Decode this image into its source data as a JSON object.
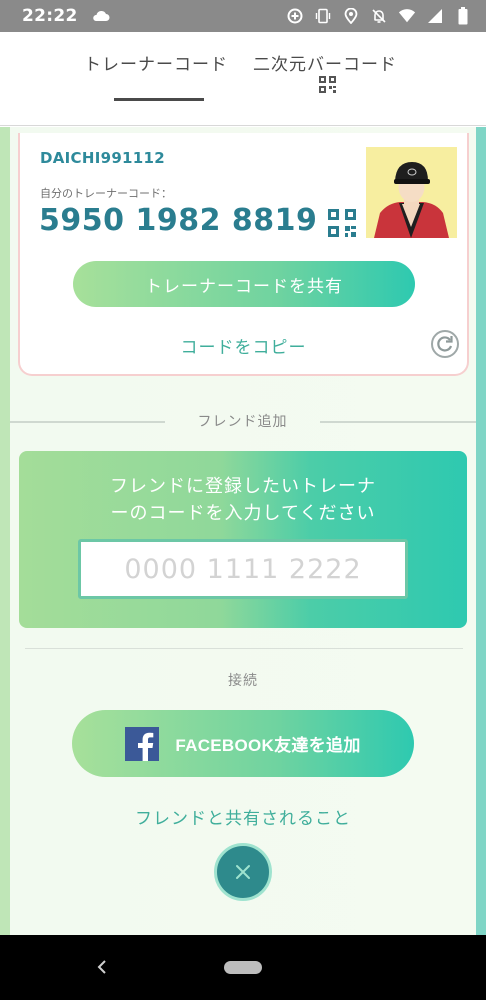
{
  "status_bar": {
    "time": "22:22",
    "icons": [
      "cloud-icon",
      "data-saver-icon",
      "vibrate-icon",
      "location-icon",
      "notifications-off-icon",
      "wifi-icon",
      "signal-icon",
      "battery-icon"
    ]
  },
  "tabs": [
    {
      "label": "トレーナーコード",
      "active": true
    },
    {
      "label": "二次元バーコード",
      "active": false,
      "icon": "qr-code-icon"
    }
  ],
  "profile": {
    "trainer_name": "DAICHI991112",
    "code_caption": "自分のトレーナーコード：",
    "trainer_code": "5950 1982 8819",
    "share_button": "トレーナーコードを共有",
    "copy_link": "コードをコピー"
  },
  "friend_add": {
    "section_label": "フレンド追加",
    "instruction_line1": "フレンドに登録したいトレーナ",
    "instruction_line2": "ーのコードを入力してください",
    "input_value": "",
    "input_placeholder": "0000 1111 2222"
  },
  "connect": {
    "section_label": "接続",
    "facebook_button": "FACEBOOK友達を追加",
    "shared_link": "フレンドと共有されること"
  },
  "colors": {
    "accent_teal": "#2a7d8f",
    "link_green": "#3fae9b",
    "gradient_start": "#a7e09a",
    "gradient_end": "#2ec9b0",
    "facebook_blue": "#3b5998"
  }
}
